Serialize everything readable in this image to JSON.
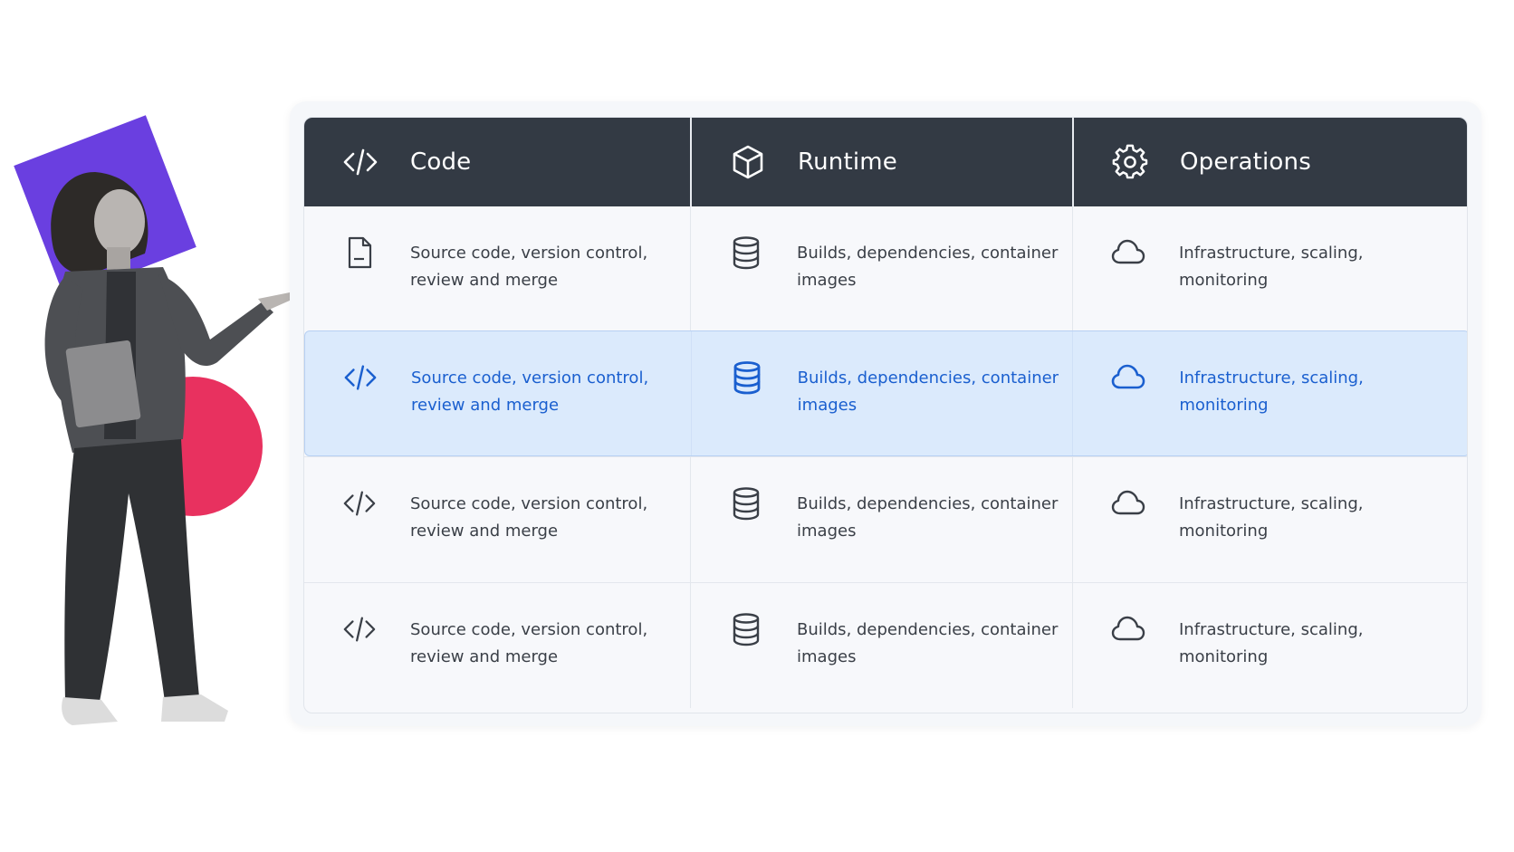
{
  "colors": {
    "header_bg": "#333a44",
    "header_text": "#ffffff",
    "body_text": "#3a3f47",
    "active_row_bg": "#dbeafc",
    "active_text": "#1a5fcf",
    "deco_purple": "#6a3fe0",
    "deco_pink": "#e8315f"
  },
  "table": {
    "columns": [
      {
        "label": "Code",
        "icon": "code-icon"
      },
      {
        "label": "Runtime",
        "icon": "cube-icon"
      },
      {
        "label": "Operations",
        "icon": "gear-icon"
      }
    ],
    "rows": [
      {
        "active": false,
        "cells": [
          {
            "icon": "document-icon",
            "text": "Source code, version control, review and merge"
          },
          {
            "icon": "database-icon",
            "text": "Builds, dependencies, container images"
          },
          {
            "icon": "cloud-icon",
            "text": "Infrastructure, scaling, monitoring"
          }
        ]
      },
      {
        "active": true,
        "cells": [
          {
            "icon": "code-icon",
            "text": "Source code, version control, review and merge"
          },
          {
            "icon": "database-icon",
            "text": "Builds, dependencies, container images"
          },
          {
            "icon": "cloud-icon",
            "text": "Infrastructure, scaling, monitoring"
          }
        ]
      },
      {
        "active": false,
        "cells": [
          {
            "icon": "code-icon",
            "text": "Source code, version control, review and merge"
          },
          {
            "icon": "database-icon",
            "text": "Builds, dependencies, container images"
          },
          {
            "icon": "cloud-icon",
            "text": "Infrastructure, scaling, monitoring"
          }
        ]
      },
      {
        "active": false,
        "cells": [
          {
            "icon": "code-icon",
            "text": "Source code, version control, review and merge"
          },
          {
            "icon": "database-icon",
            "text": "Builds, dependencies, container images"
          },
          {
            "icon": "cloud-icon",
            "text": "Infrastructure, scaling, monitoring"
          }
        ]
      }
    ]
  }
}
